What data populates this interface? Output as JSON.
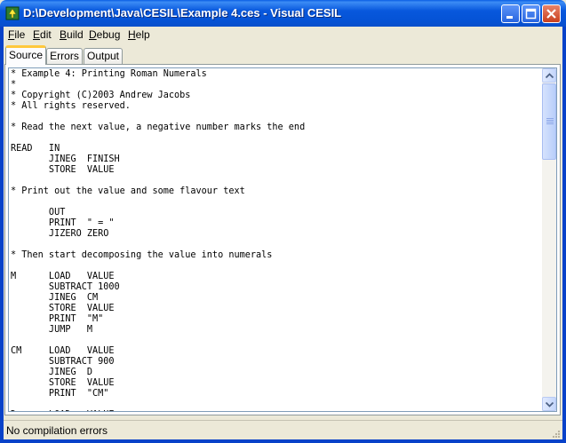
{
  "window": {
    "title": "D:\\Development\\Java\\CESIL\\Example 4.ces - Visual CESIL",
    "controls": [
      "minimize",
      "maximize",
      "close"
    ]
  },
  "menu": {
    "file": {
      "key": "F",
      "rest": "ile"
    },
    "edit": {
      "key": "E",
      "rest": "dit"
    },
    "build": {
      "key": "B",
      "rest": "uild"
    },
    "debug": {
      "key": "D",
      "rest": "ebug"
    },
    "help": {
      "key": "H",
      "rest": "elp"
    }
  },
  "tabs": {
    "source": "Source",
    "errors": "Errors",
    "output": "Output",
    "active": "Source"
  },
  "editor": {
    "lines": [
      "* Example 4: Printing Roman Numerals",
      "*",
      "* Copyright (C)2003 Andrew Jacobs",
      "* All rights reserved.",
      "",
      "* Read the next value, a negative number marks the end",
      "",
      "READ   IN",
      "       JINEG  FINISH",
      "       STORE  VALUE",
      "",
      "* Print out the value and some flavour text",
      "",
      "       OUT",
      "       PRINT  \" = \"",
      "       JIZERO ZERO",
      "",
      "* Then start decomposing the value into numerals",
      "",
      "M      LOAD   VALUE",
      "       SUBTRACT 1000",
      "       JINEG  CM",
      "       STORE  VALUE",
      "       PRINT  \"M\"",
      "       JUMP   M",
      "",
      "CM     LOAD   VALUE",
      "       SUBTRACT 900",
      "       JINEG  D",
      "       STORE  VALUE",
      "       PRINT  \"CM\"",
      "",
      "D      LOAD   VALUE"
    ]
  },
  "status": {
    "text": "No compilation errors"
  },
  "colors": {
    "title_bar": "#0858DD",
    "window_bg": "#ECE9D8",
    "active_tab_accent": "#FFC83C"
  }
}
